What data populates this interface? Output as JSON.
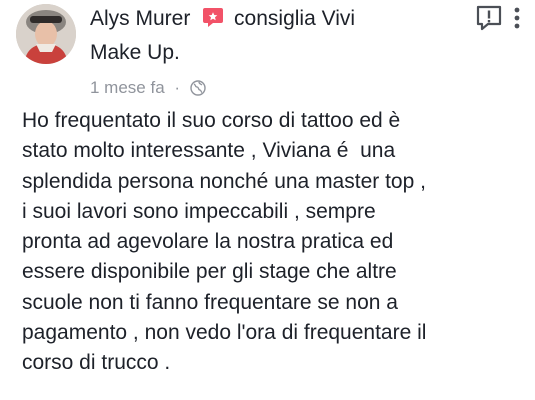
{
  "post": {
    "author": "Alys Murer",
    "action": "consiglia Vivi",
    "page_name": "Make Up.",
    "timestamp": "1 mese fa",
    "separator": "·",
    "body_lines": [
      "Ho frequentato il suo corso di tattoo ed è",
      "stato molto interessante , Viviana é  una",
      "splendida persona nonché una master top ,",
      "i suoi lavori sono impeccabili , sempre",
      "pronta ad agevolare la nostra pratica ed",
      "essere disponibile per gli stage che altre",
      "scuole non ti fanno frequentare se non a",
      "pagamento , non vedo l'ora di frequentare il",
      "corso di trucco ."
    ]
  },
  "icons": {
    "recommend": "recommend-icon",
    "privacy": "globe-icon",
    "report": "report-icon",
    "more": "more-options-icon"
  },
  "colors": {
    "recommend_red": "#f25268",
    "meta_grey": "#90949c",
    "text": "#1d2129"
  }
}
